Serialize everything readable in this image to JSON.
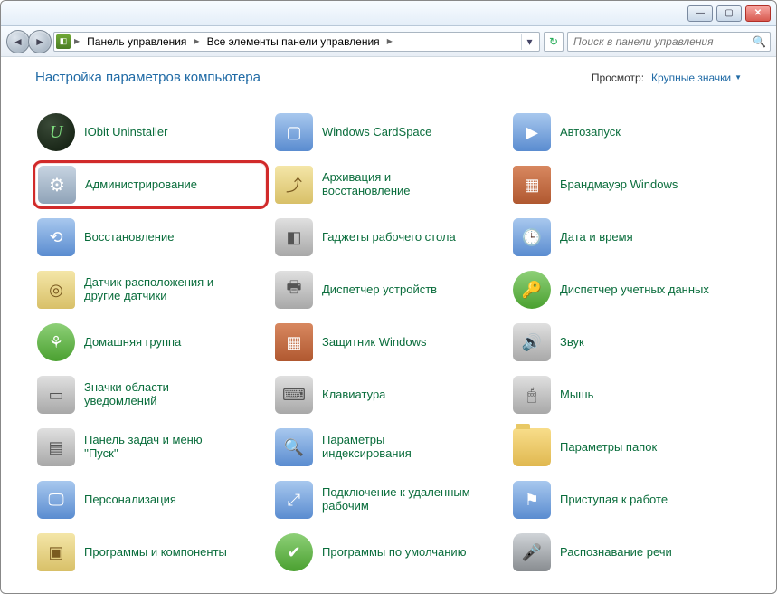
{
  "breadcrumb": {
    "segments": [
      "Панель управления",
      "Все элементы панели управления"
    ]
  },
  "search": {
    "placeholder": "Поиск в панели управления"
  },
  "heading": "Настройка параметров компьютера",
  "view": {
    "label": "Просмотр:",
    "value": "Крупные значки"
  },
  "items": [
    {
      "name": "iobit-uninstaller",
      "label": "IObit Uninstaller",
      "iconClass": "ic-circle",
      "glyph": "U"
    },
    {
      "name": "windows-cardspace",
      "label": "Windows CardSpace",
      "iconClass": "ic-blue",
      "glyph": "▢"
    },
    {
      "name": "autoplay",
      "label": "Автозапуск",
      "iconClass": "ic-blue",
      "glyph": "▶"
    },
    {
      "name": "admin-tools",
      "label": "Администрирование",
      "iconClass": "ic-gear",
      "glyph": "⚙",
      "highlight": true
    },
    {
      "name": "backup-restore",
      "label": "Архивация и восстановление",
      "iconClass": "ic-box",
      "glyph": "⤴"
    },
    {
      "name": "windows-firewall",
      "label": "Брандмауэр Windows",
      "iconClass": "ic-brick",
      "glyph": "▦"
    },
    {
      "name": "recovery",
      "label": "Восстановление",
      "iconClass": "ic-blue",
      "glyph": "⟲"
    },
    {
      "name": "desktop-gadgets",
      "label": "Гаджеты рабочего стола",
      "iconClass": "ic-gray",
      "glyph": "◧"
    },
    {
      "name": "date-time",
      "label": "Дата и время",
      "iconClass": "ic-blue",
      "glyph": "🕒"
    },
    {
      "name": "location-sensors",
      "label": "Датчик расположения и другие датчики",
      "iconClass": "ic-box",
      "glyph": "◎"
    },
    {
      "name": "device-manager",
      "label": "Диспетчер устройств",
      "iconClass": "ic-gray",
      "glyph": "🖶"
    },
    {
      "name": "credential-manager",
      "label": "Диспетчер учетных данных",
      "iconClass": "ic-green",
      "glyph": "🔑"
    },
    {
      "name": "homegroup",
      "label": "Домашняя группа",
      "iconClass": "ic-green",
      "glyph": "⚘"
    },
    {
      "name": "windows-defender",
      "label": "Защитник Windows",
      "iconClass": "ic-brick",
      "glyph": "▦"
    },
    {
      "name": "sound",
      "label": "Звук",
      "iconClass": "ic-gray",
      "glyph": "🔊"
    },
    {
      "name": "notification-icons",
      "label": "Значки области уведомлений",
      "iconClass": "ic-gray",
      "glyph": "▭"
    },
    {
      "name": "keyboard",
      "label": "Клавиатура",
      "iconClass": "ic-gray",
      "glyph": "⌨"
    },
    {
      "name": "mouse",
      "label": "Мышь",
      "iconClass": "ic-gray",
      "glyph": "🖱"
    },
    {
      "name": "taskbar-start",
      "label": "Панель задач и меню ''Пуск''",
      "iconClass": "ic-gray",
      "glyph": "▤"
    },
    {
      "name": "indexing-options",
      "label": "Параметры индексирования",
      "iconClass": "ic-blue",
      "glyph": "🔍"
    },
    {
      "name": "folder-options",
      "label": "Параметры папок",
      "iconClass": "ic-folder",
      "glyph": ""
    },
    {
      "name": "personalization",
      "label": "Персонализация",
      "iconClass": "ic-blue",
      "glyph": "🖵"
    },
    {
      "name": "remote-desktop",
      "label": "Подключение к удаленным рабочим",
      "iconClass": "ic-blue",
      "glyph": "⤢"
    },
    {
      "name": "getting-started",
      "label": "Приступая к работе",
      "iconClass": "ic-blue",
      "glyph": "⚑"
    },
    {
      "name": "programs-features",
      "label": "Программы и компоненты",
      "iconClass": "ic-box",
      "glyph": "▣"
    },
    {
      "name": "default-programs",
      "label": "Программы по умолчанию",
      "iconClass": "ic-green",
      "glyph": "✔"
    },
    {
      "name": "speech-recognition",
      "label": "Распознавание речи",
      "iconClass": "ic-mic",
      "glyph": "🎤"
    }
  ]
}
